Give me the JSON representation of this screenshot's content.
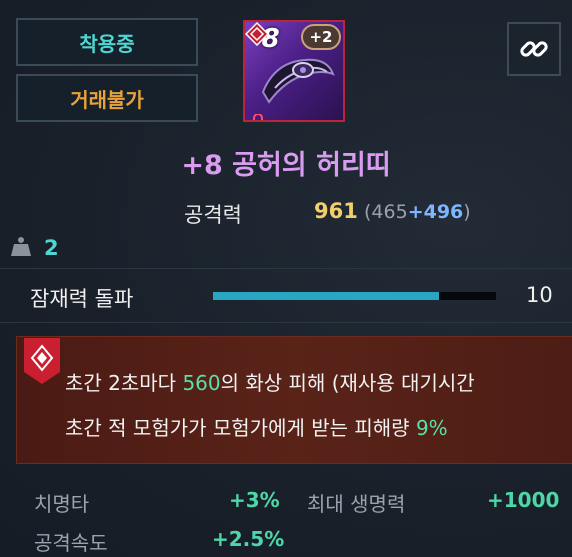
{
  "tags": {
    "equipped": "착용중",
    "untradable": "거래불가"
  },
  "item": {
    "enhance_prefix": "+",
    "enhance_level": "8",
    "bonus_badge": "+2",
    "icon_name": "waist-belt-icon",
    "lock_icon": "lock-icon",
    "grade_icon": "grade-emblem-icon",
    "name": "+8 공허의 허리띠"
  },
  "link_button": {
    "icon": "link-icon"
  },
  "primary_stat": {
    "label": "공격력",
    "value": "961",
    "detail_open": "(465",
    "detail_bonus": "+496",
    "detail_close": ")"
  },
  "weight": {
    "icon": "weight-icon",
    "value": "2"
  },
  "potential": {
    "label": "잠재력 돌파",
    "value": "10",
    "fill_fraction": 0.8
  },
  "effect": {
    "badge_icon": "skill-emblem-icon",
    "line1_pre": "초간 2초마다 ",
    "line1_hl": "560",
    "line1_post": "의 화상 피해 (재사용 대기시간",
    "line2_pre": "초간 적 모험가가 모험가에게 받는 피해량 ",
    "line2_hl": "9%"
  },
  "substats": [
    {
      "label": "치명타",
      "value": "+3%"
    },
    {
      "label": "최대 생명력",
      "value": "+1000"
    },
    {
      "label": "공격속도",
      "value": "+2.5%"
    }
  ],
  "colors": {
    "accent_teal": "#4dd7d0",
    "gold": "#f2cf6b",
    "orange": "#e8a23b",
    "item_name_purple": "#d99cf0",
    "potential_bar": "#2aa6c3",
    "effect_bg": "#5a2318"
  }
}
